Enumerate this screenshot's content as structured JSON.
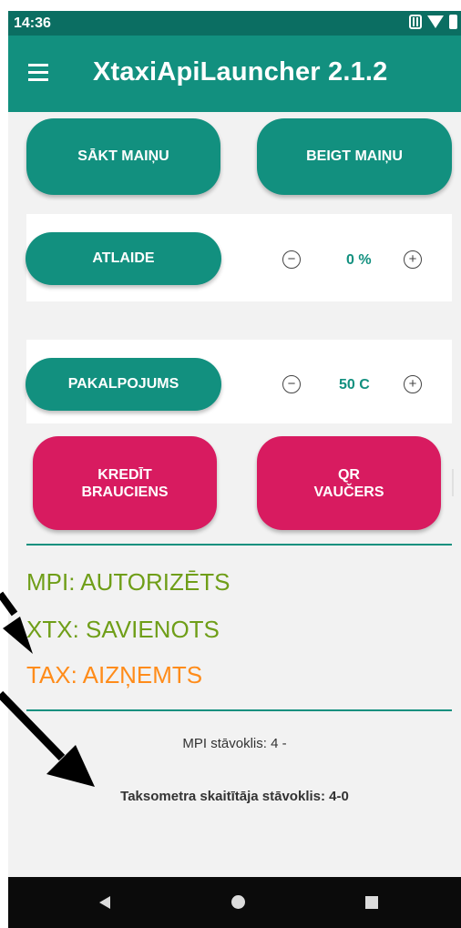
{
  "status_bar": {
    "time": "14:36",
    "icons": [
      "nfc-icon",
      "wifi-icon",
      "battery-icon"
    ]
  },
  "app_bar": {
    "title": "XtaxiApiLauncher 2.1.2",
    "menu_icon": "menu-icon"
  },
  "shift": {
    "start_label": "SĀKT MAIŅU",
    "end_label": "BEIGT MAIŅU"
  },
  "discount": {
    "button_label": "ATLAIDE",
    "value": "0 %",
    "minus_symbol": "−",
    "plus_symbol": "+"
  },
  "service": {
    "button_label": "PAKALPOJUMS",
    "value": "50 C",
    "minus_symbol": "−",
    "plus_symbol": "+"
  },
  "credit_button": {
    "line1": "KREDĪT",
    "line2": "BRAUCIENS"
  },
  "qr_button": {
    "line1": "QR",
    "line2": "VAUČERS"
  },
  "statuses": {
    "mpi": "MPI: AUTORIZĒTS",
    "xtx": "XTX: SAVIENOTS",
    "tax": "TAX: AIZŅEMTS"
  },
  "info": {
    "mpi_state": "MPI stāvoklis: 4 -",
    "taximeter_state": "Taksometra skaitītāja stāvoklis: 4-0"
  },
  "colors": {
    "primary": "#12907f",
    "primary_dark": "#0b6e62",
    "accent_pink": "#d81b60",
    "status_green": "#6f9e18",
    "status_orange": "#ff8c1a"
  },
  "nav_bar": {
    "icons": [
      "back-icon",
      "home-icon",
      "recent-apps-icon"
    ]
  }
}
